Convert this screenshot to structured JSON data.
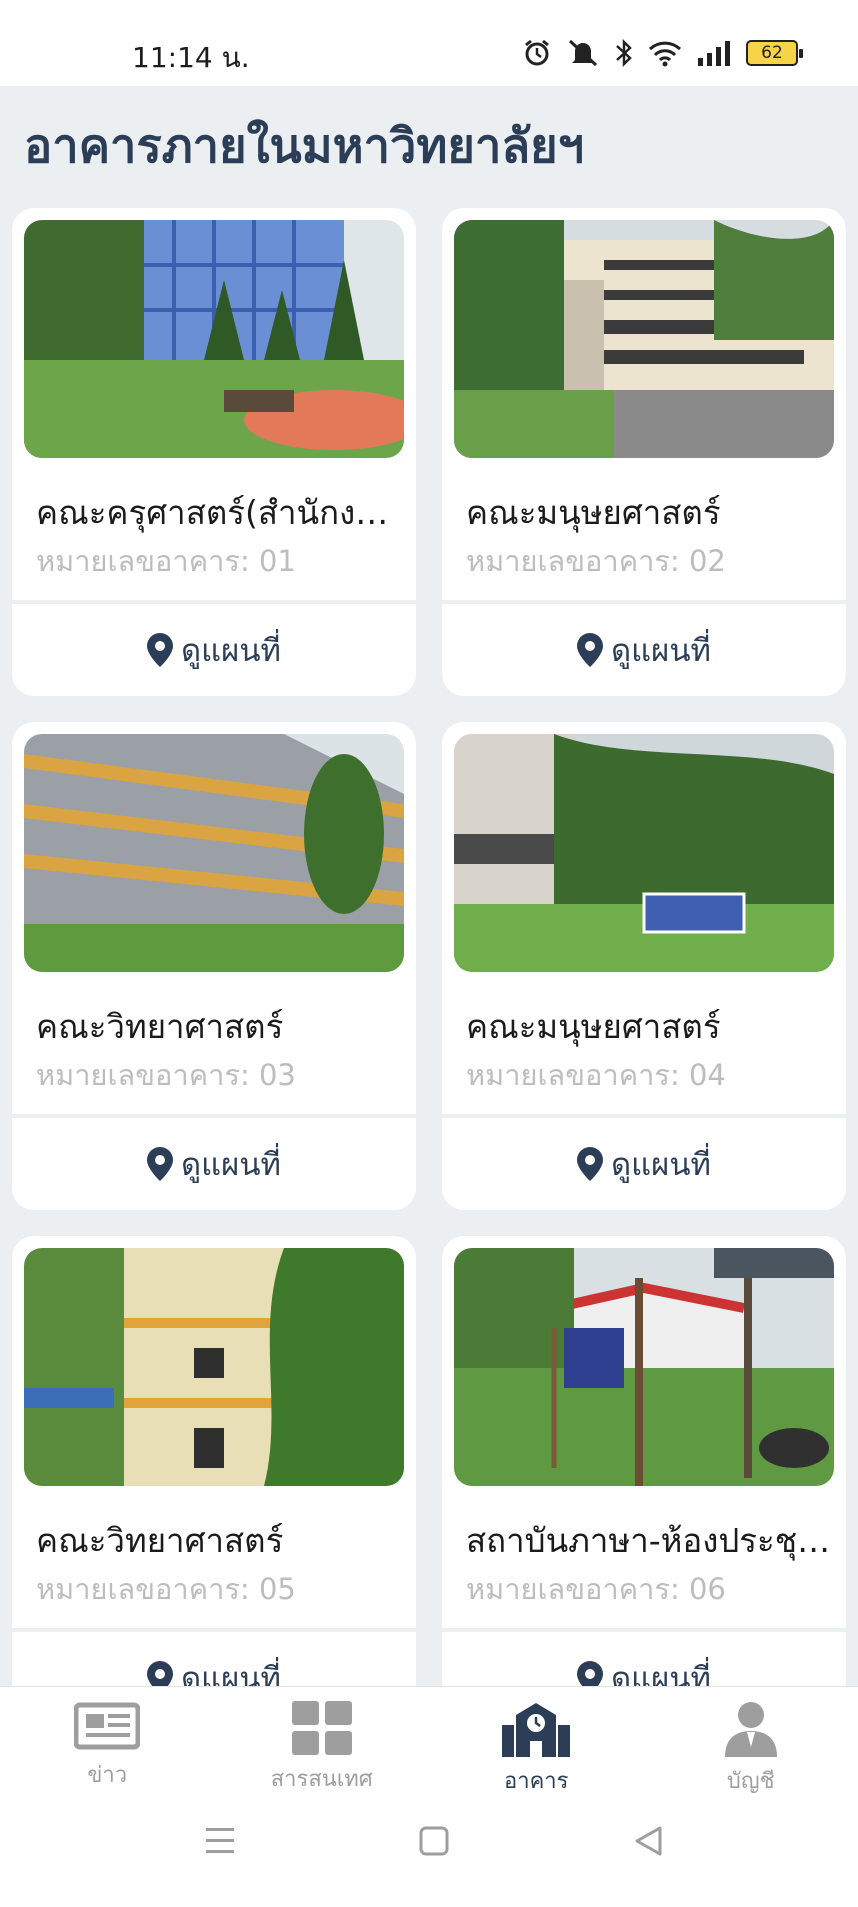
{
  "status_bar": {
    "time": "11:14 น.",
    "battery": "62"
  },
  "page_title": "อาคารภายในมหาวิทยาลัยฯ",
  "cards": [
    {
      "title": "คณะครุศาสตร์(สำนักงาน...",
      "building_no": "หมายเลขอาคาร: 01",
      "map_label": "ดูแผนที่"
    },
    {
      "title": "คณะมนุษยศาสตร์",
      "building_no": "หมายเลขอาคาร: 02",
      "map_label": "ดูแผนที่"
    },
    {
      "title": "คณะวิทยาศาสตร์",
      "building_no": "หมายเลขอาคาร: 03",
      "map_label": "ดูแผนที่"
    },
    {
      "title": "คณะมนุษยศาสตร์",
      "building_no": "หมายเลขอาคาร: 04",
      "map_label": "ดูแผนที่"
    },
    {
      "title": "คณะวิทยาศาสตร์",
      "building_no": "หมายเลขอาคาร: 05",
      "map_label": "ดูแผนที่"
    },
    {
      "title": "สถาบันภาษา-ห้องประชุม...",
      "building_no": "หมายเลขอาคาร: 06",
      "map_label": "ดูแผนที่"
    }
  ],
  "bottom_nav": [
    {
      "label": "ข่าว",
      "icon": "newspaper-icon"
    },
    {
      "label": "สารสนเทศ",
      "icon": "grid-icon"
    },
    {
      "label": "อาคาร",
      "icon": "building-icon",
      "active": true
    },
    {
      "label": "บัญชี",
      "icon": "account-icon"
    }
  ],
  "colors": {
    "accent": "#2c3e57",
    "inactive": "#9e9e9e",
    "background": "#eceff1"
  }
}
